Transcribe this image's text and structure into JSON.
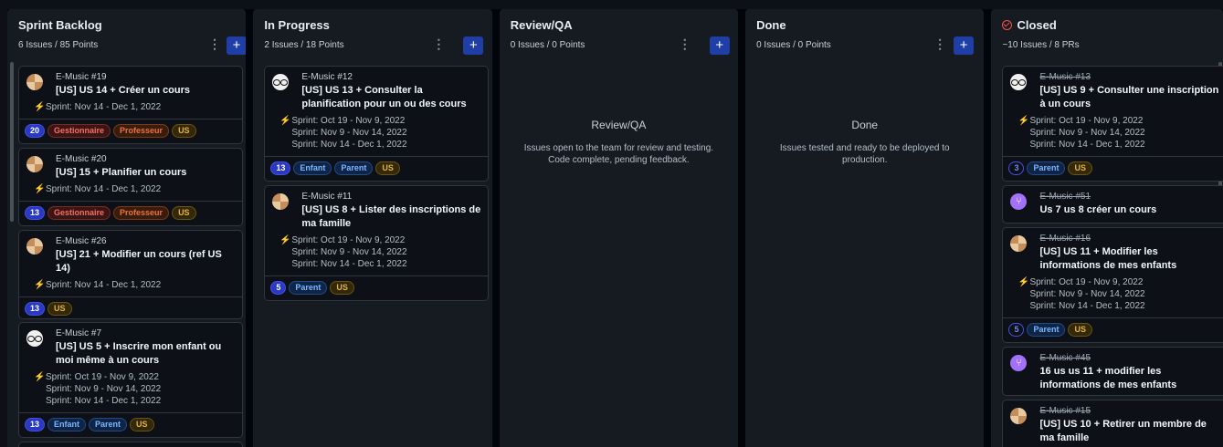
{
  "columns": [
    {
      "title": "Sprint Backlog",
      "summary": "6 Issues / 85 Points"
    },
    {
      "title": "In Progress",
      "summary": "2 Issues / 18 Points"
    },
    {
      "title": "Review/QA",
      "summary": "0 Issues / 0 Points",
      "empty_title": "Review/QA",
      "empty_desc": "Issues open to the team for review and testing. Code complete, pending feedback."
    },
    {
      "title": "Done",
      "summary": "0 Issues / 0 Points",
      "empty_title": "Done",
      "empty_desc": "Issues tested and ready to be deployed to production."
    },
    {
      "title": "Closed",
      "summary": "~10 Issues / 8 PRs"
    }
  ],
  "add_label": "+",
  "menu_label": "⋮",
  "backlog": [
    {
      "repo": "E-Music #19",
      "title": "[US] US 14 + Créer un cours",
      "sprints": [
        "Sprint: Nov 14 - Dec 1, 2022"
      ],
      "points": "20",
      "labels": [
        "Gestionnaire",
        "Professeur",
        "US"
      ]
    },
    {
      "repo": "E-Music #20",
      "title": "[US] 15 + Planifier un cours",
      "sprints": [
        "Sprint: Nov 14 - Dec 1, 2022"
      ],
      "points": "13",
      "labels": [
        "Gestionnaire",
        "Professeur",
        "US"
      ]
    },
    {
      "repo": "E-Music #26",
      "title": "[US] 21 + Modifier un cours (ref US 14)",
      "sprints": [
        "Sprint: Nov 14 - Dec 1, 2022"
      ],
      "points": "13",
      "labels": [
        "US"
      ]
    },
    {
      "repo": "E-Music #7",
      "title": "[US] US 5 + Inscrire mon enfant ou moi même à un cours",
      "sprints": [
        "Sprint: Oct 19 - Nov 9, 2022",
        "Sprint: Nov 9 - Nov 14, 2022",
        "Sprint: Nov 14 - Dec 1, 2022"
      ],
      "points": "13",
      "labels": [
        "Enfant",
        "Parent",
        "US"
      ]
    }
  ],
  "inprogress": [
    {
      "repo": "E-Music #12",
      "title": "[US] US 13 + Consulter la planification pour un ou des cours",
      "sprints": [
        "Sprint: Oct 19 - Nov 9, 2022",
        "Sprint: Nov 9 - Nov 14, 2022",
        "Sprint: Nov 14 - Dec 1, 2022"
      ],
      "points": "13",
      "labels": [
        "Enfant",
        "Parent",
        "US"
      ]
    },
    {
      "repo": "E-Music #11",
      "title": "[US] US 8 + Lister des inscriptions de ma famille",
      "sprints": [
        "Sprint: Oct 19 - Nov 9, 2022",
        "Sprint: Nov 9 - Nov 14, 2022",
        "Sprint: Nov 14 - Dec 1, 2022"
      ],
      "points": "5",
      "labels": [
        "Parent",
        "US"
      ]
    }
  ],
  "closed": [
    {
      "repo": "E-Music #13",
      "title": "[US] US 9 + Consulter une inscription à un cours",
      "sprints": [
        "Sprint: Oct 19 - Nov 9, 2022",
        "Sprint: Nov 9 - Nov 14, 2022",
        "Sprint: Nov 14 - Dec 1, 2022"
      ],
      "points": "3",
      "labels": [
        "Parent",
        "US"
      ]
    },
    {
      "repo": "E-Music #51",
      "title": "Us 7 us 8 créer un cours"
    },
    {
      "repo": "E-Music #16",
      "title": "[US] US 11 + Modifier les informations de mes enfants",
      "sprints": [
        "Sprint: Oct 19 - Nov 9, 2022",
        "Sprint: Nov 9 - Nov 14, 2022",
        "Sprint: Nov 14 - Dec 1, 2022"
      ],
      "points": "5",
      "labels": [
        "Parent",
        "US"
      ]
    },
    {
      "repo": "E-Music #45",
      "title": "16 us us 11 + modifier les informations de mes enfants"
    },
    {
      "repo": "E-Music #15",
      "title": "[US] US 10 + Retirer un membre de ma famille"
    }
  ],
  "bolt_icon": "⚡"
}
